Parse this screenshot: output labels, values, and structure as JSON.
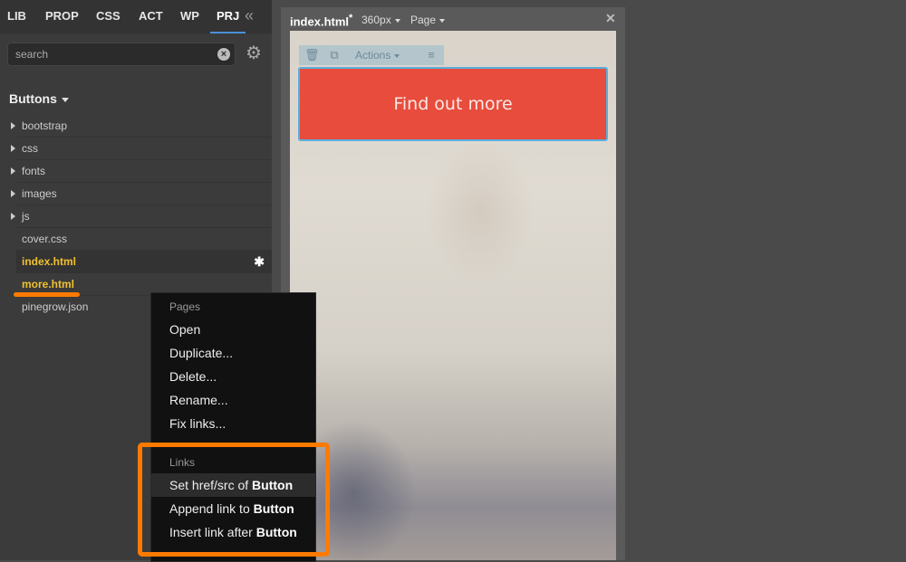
{
  "tabs": [
    {
      "label": "LIB"
    },
    {
      "label": "PROP"
    },
    {
      "label": "CSS"
    },
    {
      "label": "ACT"
    },
    {
      "label": "WP"
    },
    {
      "label": "PRJ"
    }
  ],
  "collapse_icon": "double-chevron-left-icon",
  "search": {
    "placeholder": "search",
    "value": ""
  },
  "section": {
    "title": "Buttons"
  },
  "files": [
    {
      "label": "bootstrap",
      "folder": true
    },
    {
      "label": "css",
      "folder": true
    },
    {
      "label": "fonts",
      "folder": true
    },
    {
      "label": "images",
      "folder": true
    },
    {
      "label": "js",
      "folder": true
    },
    {
      "label": "cover.css",
      "folder": false
    },
    {
      "label": "index.html",
      "folder": false,
      "modified_mark": "✱"
    },
    {
      "label": "more.html",
      "folder": false
    },
    {
      "label": "pinegrow.json",
      "folder": false
    }
  ],
  "editor": {
    "doc_name": "index.html",
    "modified": "*",
    "width_select": "360px",
    "page_select": "Page",
    "close": "✕"
  },
  "element_toolbar": {
    "actions_label": "Actions"
  },
  "preview": {
    "button_label": "Find out more"
  },
  "context_menu": {
    "pages_header": "Pages",
    "pages_items": [
      "Open",
      "Duplicate...",
      "Delete...",
      "Rename...",
      "Fix links..."
    ],
    "links_header": "Links",
    "links_items": [
      {
        "prefix": "Set href/src of ",
        "target": "Button"
      },
      {
        "prefix": "Append link to ",
        "target": "Button"
      },
      {
        "prefix": "Insert link after ",
        "target": "Button"
      }
    ]
  },
  "colors": {
    "accent": "#ff7a00",
    "button": "#e74c3c",
    "selection_outline": "#5aaee0",
    "highlight_file": "#f0c030"
  }
}
